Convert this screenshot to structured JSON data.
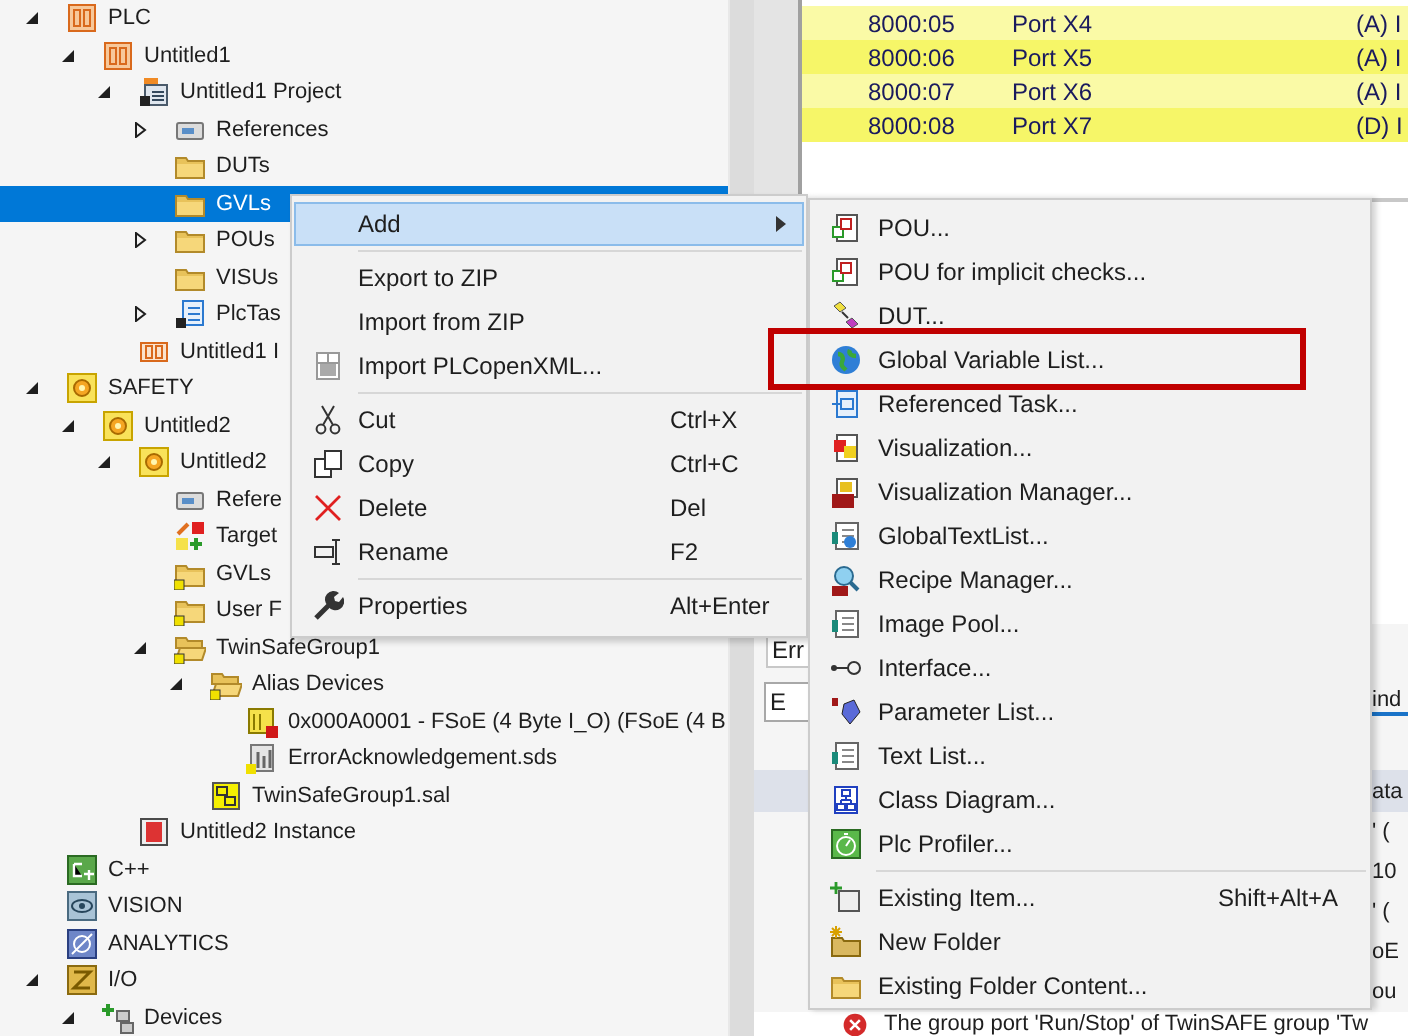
{
  "tree": [
    {
      "label": "PLC",
      "kind": "plc",
      "expandable": true,
      "expanded": true,
      "selected": false,
      "children": [
        {
          "label": "Untitled1",
          "kind": "plc",
          "expandable": true,
          "expanded": true,
          "selected": false,
          "children": [
            {
              "label": "Untitled1 Project",
              "kind": "project",
              "expandable": true,
              "expanded": true,
              "selected": false,
              "children": [
                {
                  "label": "References",
                  "kind": "references",
                  "expandable": true,
                  "expanded": false,
                  "selected": false
                },
                {
                  "label": "DUTs",
                  "kind": "folder",
                  "expandable": false,
                  "selected": false
                },
                {
                  "label": "GVLs",
                  "kind": "folder",
                  "expandable": false,
                  "selected": true
                },
                {
                  "label": "POUs",
                  "kind": "folder",
                  "expandable": true,
                  "expanded": false,
                  "selected": false
                },
                {
                  "label": "VISUs",
                  "kind": "folder",
                  "expandable": false,
                  "selected": false
                },
                {
                  "label": "PlcTas",
                  "kind": "task",
                  "expandable": true,
                  "expanded": false,
                  "selected": false
                }
              ]
            },
            {
              "label": "Untitled1 I",
              "kind": "plc-instance",
              "expandable": false,
              "selected": false
            }
          ]
        }
      ]
    },
    {
      "label": "SAFETY",
      "kind": "safety",
      "expandable": true,
      "expanded": true,
      "selected": false,
      "children": [
        {
          "label": "Untitled2",
          "kind": "safety",
          "expandable": true,
          "expanded": true,
          "selected": false,
          "children": [
            {
              "label": "Untitled2",
              "kind": "safety",
              "expandable": true,
              "expanded": true,
              "selected": false,
              "children": [
                {
                  "label": "Refere",
                  "kind": "references",
                  "expandable": false,
                  "selected": false
                },
                {
                  "label": "Target",
                  "kind": "target",
                  "expandable": false,
                  "selected": false
                },
                {
                  "label": "GVLs",
                  "kind": "badge-folder",
                  "expandable": false,
                  "selected": false
                },
                {
                  "label": "User F",
                  "kind": "badge-folder",
                  "expandable": false,
                  "selected": false
                },
                {
                  "label": "TwinSafeGroup1",
                  "kind": "open-folder",
                  "expandable": true,
                  "expanded": true,
                  "selected": false,
                  "children": [
                    {
                      "label": "Alias Devices",
                      "kind": "open-folder",
                      "expandable": true,
                      "expanded": true,
                      "selected": false,
                      "children": [
                        {
                          "label": "0x000A0001 - FSoE (4 Byte I_O) (FSoE (4 B",
                          "kind": "device",
                          "expandable": false,
                          "selected": false
                        },
                        {
                          "label": "ErrorAcknowledgement.sds",
                          "kind": "sds",
                          "expandable": false,
                          "selected": false
                        }
                      ]
                    },
                    {
                      "label": "TwinSafeGroup1.sal",
                      "kind": "sal",
                      "expandable": false,
                      "selected": false
                    }
                  ]
                }
              ]
            },
            {
              "label": "Untitled2 Instance",
              "kind": "safety-instance",
              "expandable": false,
              "selected": false
            }
          ]
        }
      ]
    },
    {
      "label": "C++",
      "kind": "cpp",
      "expandable": false,
      "selected": false
    },
    {
      "label": "VISION",
      "kind": "vision",
      "expandable": false,
      "selected": false
    },
    {
      "label": "ANALYTICS",
      "kind": "analytics",
      "expandable": false,
      "selected": false
    },
    {
      "label": "I/O",
      "kind": "io",
      "expandable": true,
      "expanded": true,
      "selected": false,
      "children": [
        {
          "label": "Devices",
          "kind": "devices",
          "expandable": true,
          "expanded": true,
          "selected": false
        }
      ]
    }
  ],
  "process_image": {
    "rows": [
      {
        "index": "8000:05",
        "name": "Port X4",
        "type": "(A) I"
      },
      {
        "index": "8000:06",
        "name": "Port X5",
        "type": "(A) I"
      },
      {
        "index": "8000:07",
        "name": "Port X6",
        "type": "(A) I"
      },
      {
        "index": "8000:08",
        "name": "Port X7",
        "type": "(D) I"
      }
    ]
  },
  "error_list": {
    "tab": "Err",
    "filter": {
      "value": "E"
    },
    "tab_right": "ind",
    "header": "ata",
    "rows": [
      "' (",
      "10",
      "' (",
      "oE",
      "ou"
    ],
    "last_message": {
      "kind": "error",
      "text": "The group port 'Run/Stop' of TwinSAFE group 'Tw"
    }
  },
  "context_menu": {
    "items": [
      {
        "kind": "plain",
        "label": "Add",
        "submenu": true,
        "selected": true
      },
      {
        "kind": "separator"
      },
      {
        "kind": "plain",
        "label": "Export to ZIP",
        "submenu": false,
        "selected": false
      },
      {
        "kind": "plain",
        "label": "Import from ZIP",
        "submenu": false,
        "selected": false
      },
      {
        "kind": "grid",
        "label": "Import PLCopenXML...",
        "submenu": false,
        "selected": false
      },
      {
        "kind": "separator"
      },
      {
        "kind": "scissors",
        "label": "Cut",
        "shortcut": "Ctrl+X",
        "submenu": false,
        "selected": false
      },
      {
        "kind": "copy",
        "label": "Copy",
        "shortcut": "Ctrl+C",
        "submenu": false,
        "selected": false
      },
      {
        "kind": "delete",
        "label": "Delete",
        "shortcut": "Del",
        "submenu": false,
        "selected": false
      },
      {
        "kind": "rename",
        "label": "Rename",
        "shortcut": "F2",
        "submenu": false,
        "selected": false
      },
      {
        "kind": "separator"
      },
      {
        "kind": "wrench",
        "label": "Properties",
        "shortcut": "Alt+Enter",
        "submenu": false,
        "selected": false
      }
    ]
  },
  "submenu": {
    "items": [
      {
        "kind": "pou",
        "label": "POU...",
        "selected": false,
        "marked": false
      },
      {
        "kind": "pou",
        "label": "POU for implicit checks...",
        "selected": false,
        "marked": false
      },
      {
        "kind": "dut",
        "label": "DUT...",
        "selected": false,
        "marked": false
      },
      {
        "kind": "globe",
        "label": "Global Variable List...",
        "selected": false,
        "marked": true
      },
      {
        "kind": "ref-task",
        "label": "Referenced Task...",
        "selected": false,
        "marked": false
      },
      {
        "kind": "visualization",
        "label": "Visualization...",
        "selected": false,
        "marked": false
      },
      {
        "kind": "vis-manager",
        "label": "Visualization Manager...",
        "selected": false,
        "marked": false
      },
      {
        "kind": "text-globe",
        "label": "GlobalTextList...",
        "selected": false,
        "marked": false
      },
      {
        "kind": "recipe",
        "label": "Recipe Manager...",
        "selected": false,
        "marked": false
      },
      {
        "kind": "list-doc",
        "label": "Image Pool...",
        "selected": false,
        "marked": false
      },
      {
        "kind": "interface",
        "label": "Interface...",
        "selected": false,
        "marked": false
      },
      {
        "kind": "parameter",
        "label": "Parameter List...",
        "selected": false,
        "marked": false
      },
      {
        "kind": "list-doc",
        "label": "Text List...",
        "selected": false,
        "marked": false
      },
      {
        "kind": "class-diagram",
        "label": "Class Diagram...",
        "selected": false,
        "marked": false
      },
      {
        "kind": "profiler",
        "label": "Plc Profiler...",
        "selected": false,
        "marked": false
      },
      {
        "kind": "separator"
      },
      {
        "kind": "existing-item",
        "label": "Existing Item...",
        "shortcut": "Shift+Alt+A",
        "selected": false,
        "marked": false
      },
      {
        "kind": "new-folder",
        "label": "New Folder",
        "selected": false,
        "marked": false
      },
      {
        "kind": "folder",
        "label": "Existing Folder Content...",
        "selected": false,
        "marked": false
      }
    ]
  }
}
